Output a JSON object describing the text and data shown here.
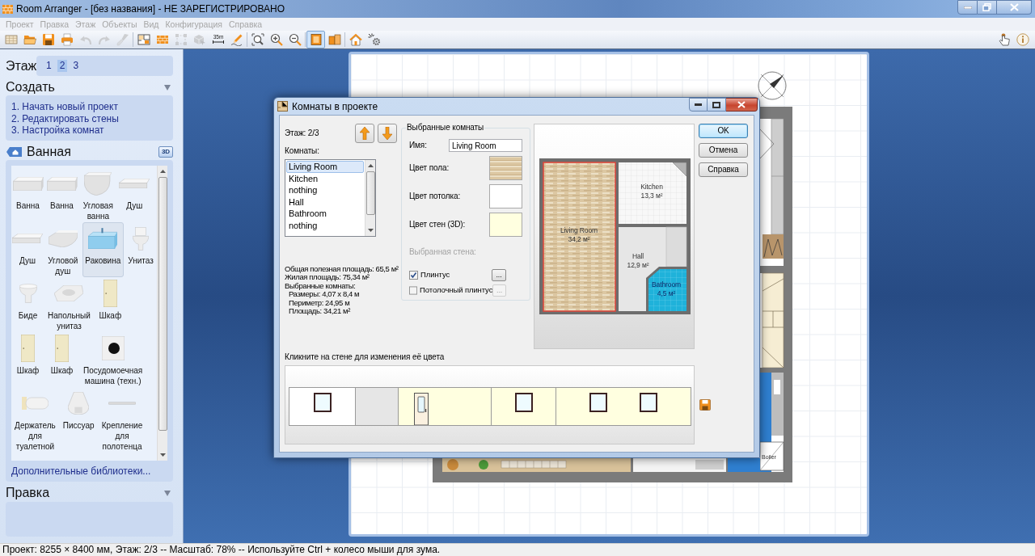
{
  "window": {
    "title": "Room Arranger - [без названия] - НЕ ЗАРЕГИСТРИРОВАНО"
  },
  "menu": [
    {
      "label": "Проект",
      "disabled": true
    },
    {
      "label": "Правка",
      "disabled": true
    },
    {
      "label": "Этаж",
      "disabled": true
    },
    {
      "label": "Объекты",
      "disabled": true
    },
    {
      "label": "Вид",
      "disabled": true
    },
    {
      "label": "Конфигурация",
      "disabled": true
    },
    {
      "label": "Справка",
      "disabled": true
    }
  ],
  "toolbar": {
    "groups": [
      [
        {
          "kind": "sheet",
          "disabled": false,
          "pressed": false
        },
        {
          "kind": "folder",
          "disabled": false,
          "pressed": false
        },
        {
          "kind": "floppy",
          "disabled": false,
          "pressed": false
        },
        {
          "kind": "printer",
          "disabled": false,
          "pressed": false
        },
        {
          "kind": "undo",
          "disabled": true,
          "pressed": false
        },
        {
          "kind": "redo",
          "disabled": true,
          "pressed": false
        },
        {
          "kind": "brush",
          "disabled": true,
          "pressed": false
        }
      ],
      [
        {
          "kind": "plan",
          "disabled": false,
          "pressed": false
        },
        {
          "kind": "bricks",
          "disabled": false,
          "pressed": false
        },
        {
          "kind": "dashed-square",
          "disabled": true,
          "pressed": false
        },
        {
          "kind": "box-arrow",
          "disabled": true,
          "pressed": false
        },
        {
          "kind": "ruler",
          "label": "35m",
          "disabled": false,
          "pressed": false
        },
        {
          "kind": "pencil",
          "disabled": false,
          "pressed": false
        }
      ],
      [
        {
          "kind": "zoom-fit",
          "disabled": false,
          "pressed": false
        },
        {
          "kind": "zoom-in",
          "disabled": false,
          "pressed": false
        },
        {
          "kind": "zoom-out",
          "disabled": false,
          "pressed": false
        }
      ],
      [
        {
          "kind": "box",
          "disabled": false,
          "pressed": true
        },
        {
          "kind": "boxes",
          "disabled": false,
          "pressed": false
        }
      ],
      [
        {
          "kind": "house",
          "disabled": false,
          "pressed": false
        },
        {
          "kind": "gear-sparkle",
          "disabled": false,
          "pressed": false
        }
      ]
    ],
    "right": [
      {
        "kind": "hand",
        "disabled": false,
        "pressed": false
      },
      {
        "kind": "info",
        "disabled": false,
        "pressed": false
      }
    ]
  },
  "sidebar": {
    "floor": {
      "label": "Этаж",
      "tabs": [
        {
          "label": "1",
          "selected": false
        },
        {
          "label": "2",
          "selected": true
        },
        {
          "label": "3",
          "selected": false
        }
      ]
    },
    "create": {
      "title": "Создать",
      "expanded": true,
      "links": [
        "1. Начать новый проект",
        "2. Редактировать стены",
        "3. Настройка комнат"
      ]
    },
    "library": {
      "title": "Ванная",
      "view_button": "3D",
      "rows": [
        [
          {
            "label": "Ванна",
            "kind": "bathtub",
            "selected": false
          },
          {
            "label": "Ванна",
            "kind": "bathtub",
            "selected": false
          },
          {
            "label": "Угловая ванна",
            "kind": "corner-bathtub",
            "selected": false
          },
          {
            "label": "Душ",
            "kind": "shower",
            "selected": false
          }
        ],
        [
          {
            "label": "Душ",
            "kind": "shower",
            "selected": false
          },
          {
            "label": "Угловой душ",
            "kind": "corner-shower",
            "selected": false
          },
          {
            "label": "Раковина",
            "kind": "sink",
            "selected": true
          },
          {
            "label": "Унитаз",
            "kind": "toilet",
            "selected": false
          }
        ],
        [
          {
            "label": "Биде",
            "kind": "bidet",
            "selected": false
          },
          {
            "label": "Напольный унитаз",
            "kind": "floor-toilet",
            "selected": false
          },
          {
            "label": "Шкаф",
            "kind": "cabinet",
            "selected": false
          }
        ],
        [
          {
            "label": "Шкаф",
            "kind": "cabinet",
            "selected": false
          },
          {
            "label": "Шкаф",
            "kind": "cabinet",
            "selected": false
          },
          {
            "label": "Посудомоечная машина (техн.)",
            "kind": "washer",
            "selected": false
          }
        ],
        [
          {
            "label": "Держатель для туалетной",
            "kind": "paper-holder",
            "selected": false
          },
          {
            "label": "Писсуар",
            "kind": "urinal",
            "selected": false
          },
          {
            "label": "Крепление для полотенца",
            "kind": "towel-rail",
            "selected": false
          }
        ]
      ],
      "more_link": "Дополнительные библиотеки..."
    },
    "edit": {
      "title": "Правка",
      "expanded": true
    }
  },
  "canvas": {
    "fixture_label": "Boiler"
  },
  "dialog": {
    "title": "Комнаты в проекте",
    "floor_label": "Этаж: 2/3",
    "rooms_label": "Комнаты:",
    "rooms": [
      {
        "name": "Living Room",
        "selected": true
      },
      {
        "name": "Kitchen",
        "selected": false
      },
      {
        "name": "nothing",
        "selected": false
      },
      {
        "name": "Hall",
        "selected": false
      },
      {
        "name": "Bathroom",
        "selected": false
      },
      {
        "name": "nothing",
        "selected": false
      }
    ],
    "summary": [
      "Общая полезная площадь: 65,5 м²",
      "Жилая площадь: 75,34 м²"
    ],
    "selection": {
      "heading": "Выбранные комнаты:",
      "details": [
        "Размеры: 4,07 x 8,4 м",
        "Периметр: 24,95 м",
        "Площадь: 34,21 м²"
      ]
    },
    "group": {
      "title": "Выбранные комнаты",
      "name_label": "Имя:",
      "name_value": "Living Room",
      "swatches": [
        {
          "label": "Цвет пола:",
          "kind": "wood"
        },
        {
          "label": "Цвет потолка:",
          "kind": "solid",
          "color": "#ffffff"
        },
        {
          "label": "Цвет стен (3D):",
          "kind": "solid",
          "color": "#ffffe0"
        }
      ],
      "wall_label": {
        "text": "Выбранная стена:",
        "disabled": true
      },
      "options": [
        {
          "label": "Плинтус",
          "checked": true,
          "button": {
            "label": "...",
            "disabled": false
          }
        },
        {
          "label": "Потолочный плинтус",
          "checked": false,
          "button": {
            "label": "...",
            "disabled": true
          }
        }
      ]
    },
    "preview": {
      "rooms": [
        {
          "name": "Living Room",
          "area": "34,2 м²",
          "kind": "wood",
          "selected": true
        },
        {
          "name": "Kitchen",
          "area": "13,3 м²",
          "kind": "white-tile",
          "selected": false
        },
        {
          "name": "Hall",
          "area": "12,9 м²",
          "kind": "grey",
          "selected": false
        },
        {
          "name": "Bathroom",
          "area": "4,5 м²",
          "kind": "blue-tile",
          "selected": false
        }
      ]
    },
    "buttons": [
      {
        "label": "OK",
        "default": true
      },
      {
        "label": "Отмена",
        "default": false
      },
      {
        "label": "Справка",
        "default": false
      }
    ],
    "hint": "Кликните на стене для изменения её цвета",
    "walls": [
      {
        "color": "#ffffff",
        "openings": [
          {
            "kind": "window"
          }
        ]
      },
      {
        "color": "#e6e6e6"
      },
      {
        "color": "#ffffe0",
        "openings": [
          {
            "kind": "door"
          }
        ]
      },
      {
        "color": "#ffffe0",
        "openings": [
          {
            "kind": "window"
          }
        ]
      },
      {
        "color": "#ffffe0",
        "openings": [
          {
            "kind": "window"
          },
          {
            "kind": "window"
          }
        ]
      }
    ]
  },
  "status_bar": "Проект: 8255 × 8400 мм, Этаж: 2/3 -- Масштаб: 78% -- Используйте Ctrl + колесо мыши для зума."
}
